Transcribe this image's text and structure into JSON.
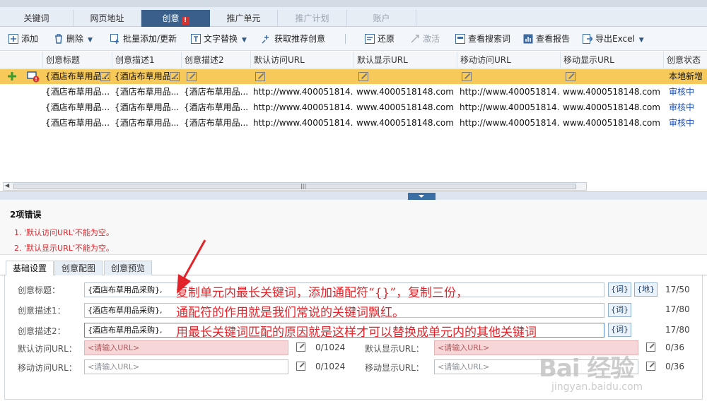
{
  "tabs": [
    {
      "label": "关键词",
      "state": "normal"
    },
    {
      "label": "网页地址",
      "state": "normal"
    },
    {
      "label": "创意",
      "state": "active",
      "badge": "!"
    },
    {
      "label": "推广单元",
      "state": "normal"
    },
    {
      "label": "推广计划",
      "state": "disabled"
    },
    {
      "label": "账户",
      "state": "disabled"
    }
  ],
  "toolbar": {
    "add": "添加",
    "delete": "删除",
    "batch_add": "批量添加/更新",
    "text_replace": "文字替换",
    "get_recommend": "获取推荐创意",
    "restore": "还原",
    "activate": "激活",
    "view_search_terms": "查看搜索词",
    "view_report": "查看报告",
    "export": "导出Excel"
  },
  "grid": {
    "columns": [
      "创意标题",
      "创意描述1",
      "创意描述2",
      "默认访问URL",
      "默认显示URL",
      "移动访问URL",
      "移动显示URL",
      "创意状态"
    ],
    "rows": [
      {
        "title": "{酒店布草用品...",
        "desc1": "{酒店布草用品...",
        "desc2": "",
        "url": "",
        "disp": "",
        "murl": "",
        "mdisp": "",
        "status": "本地新增",
        "selected": true
      },
      {
        "title": "{酒店布草用品...",
        "desc1": "{酒店布草用品...",
        "desc2": "{酒店布草用品...",
        "url": "http://www.400051814...",
        "disp": "www.4000518148.com",
        "murl": "http://www.400051814...",
        "mdisp": "www.4000518148.com",
        "status": "审核中",
        "selected": false
      },
      {
        "title": "{酒店布草用品...",
        "desc1": "{酒店布草用品...",
        "desc2": "{酒店布草用品...",
        "url": "http://www.400051814...",
        "disp": "www.4000518148.com",
        "murl": "http://www.400051814...",
        "mdisp": "www.4000518148.com",
        "status": "审核中",
        "selected": false
      },
      {
        "title": "{酒店布草用品...",
        "desc1": "{酒店布草用品...",
        "desc2": "{酒店布草用品...",
        "url": "http://www.400051814...",
        "disp": "www.4000518148.com",
        "murl": "http://www.400051814...",
        "mdisp": "www.4000518148.com",
        "status": "审核中",
        "selected": false
      }
    ]
  },
  "errors": {
    "title": "2项错误",
    "items": [
      "1. '默认访问URL'不能为空。",
      "2. '默认显示URL'不能为空。"
    ]
  },
  "form_tabs": [
    "基础设置",
    "创意配图",
    "创意预览"
  ],
  "form": {
    "title_label": "创意标题：",
    "title_value": "{酒店布草用品采购},",
    "title_count": "17/50",
    "desc1_label": "创意描述1：",
    "desc1_value": "{酒店布草用品采购},",
    "desc1_count": "17/80",
    "desc2_label": "创意描述2：",
    "desc2_value": "{酒店布草用品采购},",
    "desc2_count": "17/80",
    "word_btn": "{词}",
    "place_btn": "{地}",
    "url_label": "默认访问URL：",
    "url_placeholder": "<请输入URL>",
    "url_count": "0/1024",
    "disp_label": "默认显示URL：",
    "disp_placeholder": "<请输入URL>",
    "disp_count": "0/36",
    "murl_label": "移动访问URL：",
    "murl_placeholder": "<请输入URL>",
    "murl_count": "0/1024",
    "mdisp_label": "移动显示URL：",
    "mdisp_placeholder": "<请输入URL>",
    "mdisp_count": "0/36"
  },
  "annotation": {
    "line1": "复制单元内最长关键词，添加通配符“{}”，复制三份，",
    "line2": "通配符的作用就是我们常说的关键词飘红。",
    "line3": "用最长关键词匹配的原因就是这样才可以替换成单元内的其他关键词",
    "color": "#e2242a"
  },
  "watermark": {
    "main": "Bai 经验",
    "sub": "jingyan.baidu.com"
  },
  "colors": {
    "accent": "#3a5f8a",
    "selected_row": "#f7c95a",
    "error": "#e0262d",
    "status_link": "#1d4fb8"
  }
}
